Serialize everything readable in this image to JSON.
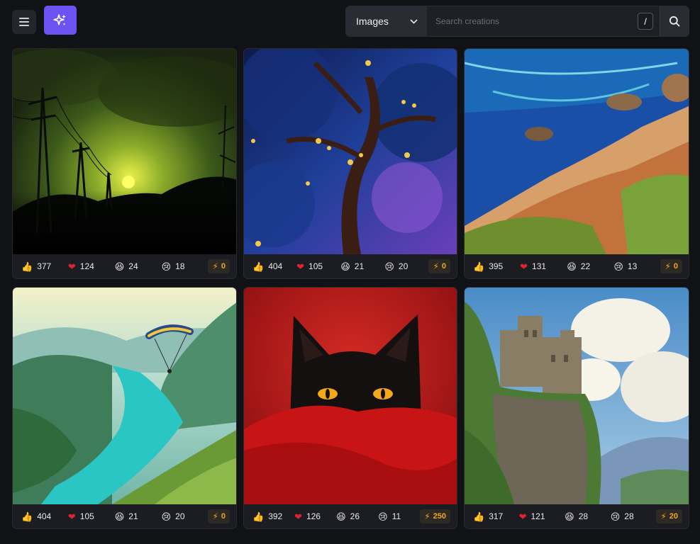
{
  "header": {
    "type_select_value": "Images",
    "search_placeholder": "Search creations",
    "shortcut_key": "/"
  },
  "icons": {
    "menu": "hamburger-icon",
    "create": "sparkle-icon",
    "search": "search-icon",
    "like": "thumbs-up",
    "love": "heart",
    "laugh": "laughing-face",
    "sad": "sad-face",
    "boost": "bolt"
  },
  "colors": {
    "accent": "#6c52f0",
    "boost": "#f5a524",
    "heart": "#e0242f"
  },
  "cards": [
    {
      "likes": "377",
      "hearts": "124",
      "laughs": "24",
      "sads": "18",
      "boosts": "0"
    },
    {
      "likes": "404",
      "hearts": "105",
      "laughs": "21",
      "sads": "20",
      "boosts": "0"
    },
    {
      "likes": "395",
      "hearts": "131",
      "laughs": "22",
      "sads": "13",
      "boosts": "0"
    },
    {
      "likes": "404",
      "hearts": "105",
      "laughs": "21",
      "sads": "20",
      "boosts": "0"
    },
    {
      "likes": "392",
      "hearts": "126",
      "laughs": "26",
      "sads": "11",
      "boosts": "250"
    },
    {
      "likes": "317",
      "hearts": "121",
      "laughs": "28",
      "sads": "28",
      "boosts": "20"
    }
  ]
}
